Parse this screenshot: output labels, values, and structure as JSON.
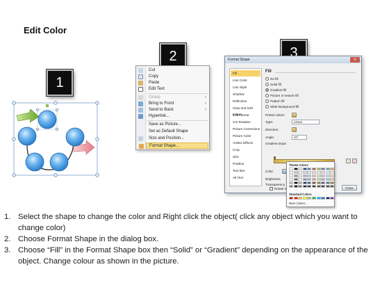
{
  "title": "Edit Color",
  "steps": {
    "one": "1",
    "two": "2",
    "three": "3"
  },
  "context_menu": {
    "items": [
      {
        "label": "Cut",
        "enabled": true
      },
      {
        "label": "Copy",
        "enabled": true
      },
      {
        "label": "Paste",
        "enabled": true
      },
      {
        "label": "Edit Text",
        "enabled": true
      },
      {
        "label": "Group",
        "enabled": false,
        "submenu": true
      },
      {
        "label": "Bring to Front",
        "enabled": true,
        "submenu": true
      },
      {
        "label": "Send to Back",
        "enabled": true,
        "submenu": true
      },
      {
        "label": "Hyperlink...",
        "enabled": true
      },
      {
        "label": "Save as Picture...",
        "enabled": true
      },
      {
        "label": "Set as Default Shape",
        "enabled": true
      },
      {
        "label": "Size and Position...",
        "enabled": true
      },
      {
        "label": "Format Shape...",
        "enabled": true,
        "selected": true
      }
    ]
  },
  "format_shape": {
    "title": "Format Shape",
    "close_glyph": "✕",
    "nav": [
      "Fill",
      "Line Color",
      "Line Style",
      "Shadow",
      "Reflection",
      "Glow and Soft Edges",
      "3-D Format",
      "3-D Rotation",
      "Picture Corrections",
      "Picture Color",
      "Artistic Effects",
      "Crop",
      "Size",
      "Position",
      "Text Box",
      "Alt Text"
    ],
    "nav_active": "Fill",
    "section": "Fill",
    "fill_options": [
      {
        "label": "No fill",
        "checked": false
      },
      {
        "label": "Solid fill",
        "checked": false
      },
      {
        "label": "Gradient fill",
        "checked": true
      },
      {
        "label": "Picture or texture fill",
        "checked": false
      },
      {
        "label": "Pattern fill",
        "checked": false
      },
      {
        "label": "Slide background fill",
        "checked": false
      }
    ],
    "preset_colors_label": "Preset colors:",
    "type_label": "Type:",
    "type_value": "Linear",
    "direction_label": "Direction:",
    "angle_label": "Angle:",
    "angle_value": "20°",
    "gradient_stops_label": "Gradient stops",
    "color_label": "Color",
    "position_label": "Position:",
    "position_value": "0%",
    "brightness_label": "Brightness",
    "transparency_label": "Transparency",
    "rotate_label": "Rotate with shape",
    "close_button": "Close"
  },
  "palette": {
    "theme_label": "Theme Colors",
    "standard_label": "Standard Colors",
    "more_label": "More Colors...",
    "theme_top_row": [
      "#ffffff",
      "#000000",
      "#eeece1",
      "#1f497d",
      "#4f81bd",
      "#c0504d",
      "#9bbb59",
      "#8064a2",
      "#4bacc6",
      "#f79646"
    ],
    "standard_row": [
      "#c00000",
      "#ff0000",
      "#ffc000",
      "#ffff00",
      "#92d050",
      "#00b050",
      "#00b0f0",
      "#0070c0",
      "#002060",
      "#7030a0"
    ]
  },
  "instructions": [
    {
      "num": "1.",
      "text": "Select the shape to change the color and Right click the object( click any object which you want to change color)"
    },
    {
      "num": "2.",
      "text": "Choose Format Shape in the dialog box."
    },
    {
      "num": "3.",
      "text": "Choose “Fill” in the Format Shape box then “Solid” or “Gradient” depending on the appearance of the object. Change colour as shown in the picture."
    }
  ]
}
